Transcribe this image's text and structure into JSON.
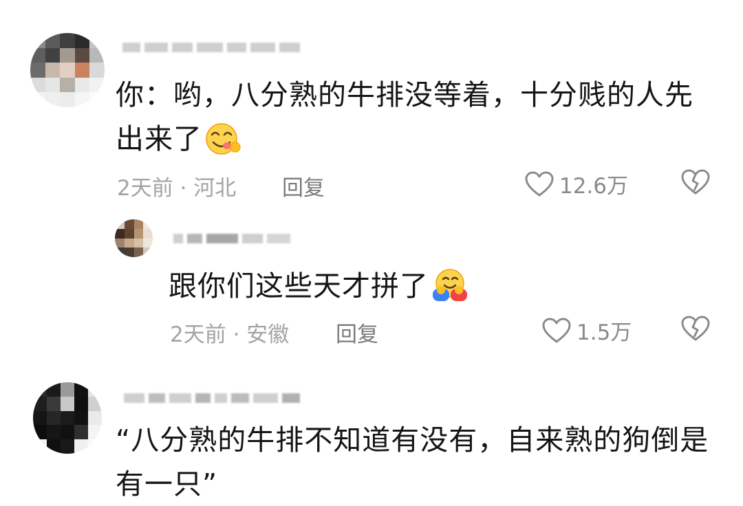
{
  "comments": [
    {
      "text": "你：哟，八分熟的牛排没等着，十分贱的人先出来了",
      "emoji": "yum-face",
      "time": "2天前",
      "location": "· 河北",
      "reply_label": "回复",
      "likes": "12.6万",
      "replies": [
        {
          "text": "跟你们这些天才拼了",
          "emoji": "hugging-face",
          "time": "2天前",
          "location": "· 安徽",
          "reply_label": "回复",
          "likes": "1.5万"
        }
      ]
    },
    {
      "text": "“八分熟的牛排不知道有没有，自来熟的狗倒是有一只”"
    }
  ],
  "icons": {
    "like": "heart-outline-icon",
    "dislike": "broken-heart-icon"
  }
}
